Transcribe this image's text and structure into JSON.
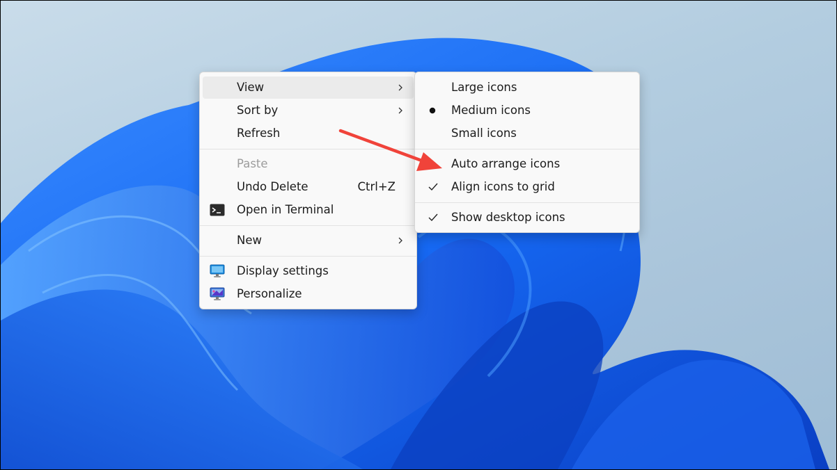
{
  "context_menu": {
    "items": [
      {
        "label": "View"
      },
      {
        "label": "Sort by"
      },
      {
        "label": "Refresh"
      },
      {
        "label": "Paste"
      },
      {
        "label": "Undo Delete",
        "shortcut": "Ctrl+Z"
      },
      {
        "label": "Open in Terminal"
      },
      {
        "label": "New"
      },
      {
        "label": "Display settings"
      },
      {
        "label": "Personalize"
      }
    ]
  },
  "view_submenu": {
    "items": [
      {
        "label": "Large icons"
      },
      {
        "label": "Medium icons",
        "selected": true
      },
      {
        "label": "Small icons"
      },
      {
        "label": "Auto arrange icons",
        "checked": false
      },
      {
        "label": "Align icons to grid",
        "checked": true
      },
      {
        "label": "Show desktop icons",
        "checked": true
      }
    ]
  },
  "annotation": {
    "arrow_color": "#f0433a",
    "arrow_target": "Auto arrange icons"
  },
  "colors": {
    "menu_bg": "#f9f9f9",
    "hover": "#ebebeb",
    "wallpaper_blue": "#1560f0"
  }
}
